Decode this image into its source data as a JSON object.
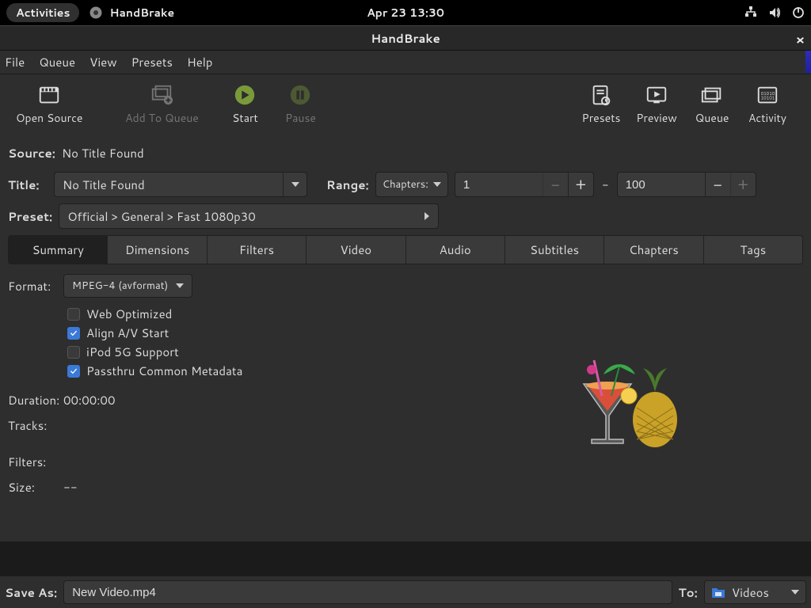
{
  "gnome": {
    "activities": "Activities",
    "app_name": "HandBrake",
    "clock": "Apr 23  13:30"
  },
  "window": {
    "title": "HandBrake"
  },
  "menu": {
    "file": "File",
    "queue": "Queue",
    "view": "View",
    "presets": "Presets",
    "help": "Help"
  },
  "toolbar": {
    "open_source": "Open Source",
    "add_queue": "Add To Queue",
    "start": "Start",
    "pause": "Pause",
    "presets": "Presets",
    "preview": "Preview",
    "queue": "Queue",
    "activity": "Activity"
  },
  "source": {
    "label": "Source:",
    "value": "No Title Found"
  },
  "title": {
    "label": "Title:",
    "value": "No Title Found"
  },
  "range": {
    "label": "Range:",
    "mode": "Chapters:",
    "start": "1",
    "end": "100",
    "sep": "-"
  },
  "preset": {
    "label": "Preset:",
    "value": "Official > General > Fast 1080p30"
  },
  "tabs": {
    "summary": "Summary",
    "dimensions": "Dimensions",
    "filters": "Filters",
    "video": "Video",
    "audio": "Audio",
    "subtitles": "Subtitles",
    "chapters": "Chapters",
    "tags": "Tags"
  },
  "summary": {
    "format_label": "Format:",
    "format_value": "MPEG-4 (avformat)",
    "web_opt": "Web Optimized",
    "align_av": "Align A/V Start",
    "ipod": "iPod 5G Support",
    "passthru": "Passthru Common Metadata",
    "duration_label": "Duration:",
    "duration_value": "00:00:00",
    "tracks_label": "Tracks:",
    "filters_label": "Filters:",
    "size_label": "Size:",
    "size_value": "--"
  },
  "save": {
    "label": "Save As:",
    "filename": "New Video.mp4",
    "to_label": "To:",
    "folder": "Videos"
  }
}
